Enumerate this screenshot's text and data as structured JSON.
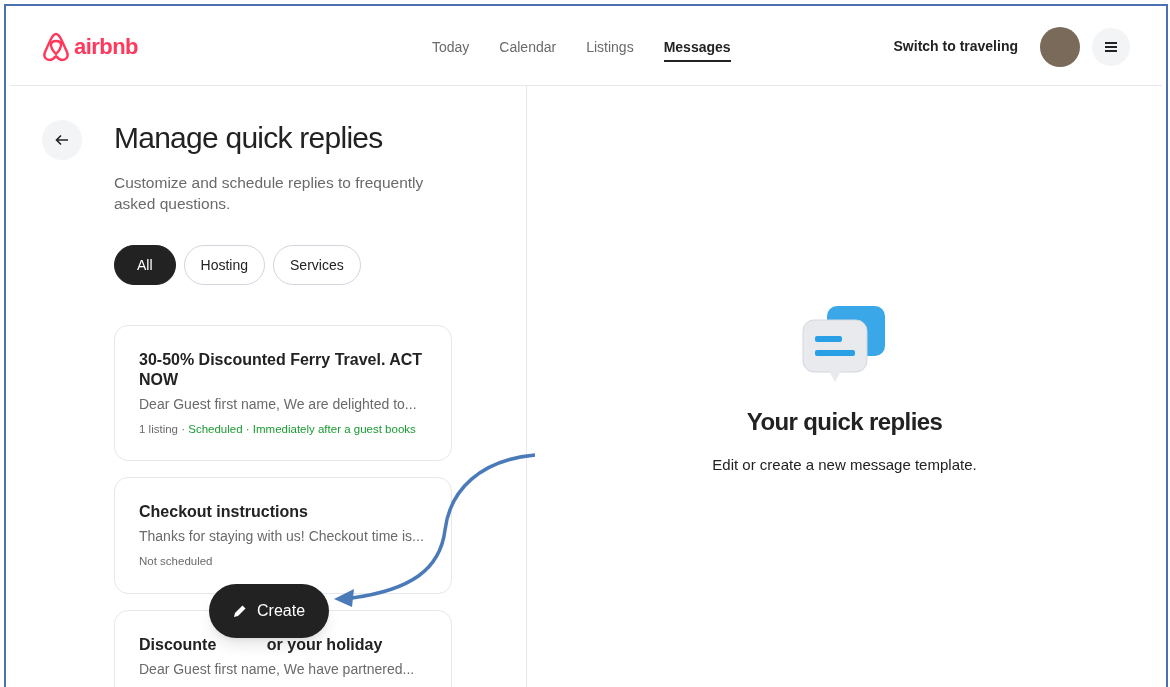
{
  "header": {
    "logo": "airbnb",
    "nav": [
      {
        "label": "Today",
        "selected": false
      },
      {
        "label": "Calendar",
        "selected": false
      },
      {
        "label": "Listings",
        "selected": false
      },
      {
        "label": "Messages",
        "selected": true
      }
    ],
    "switch_link": "Switch to traveling"
  },
  "panel": {
    "title": "Manage quick replies",
    "subtitle": "Customize and schedule replies to frequently asked questions.",
    "filters": [
      {
        "label": "All",
        "selected": true
      },
      {
        "label": "Hosting",
        "selected": false
      },
      {
        "label": "Services",
        "selected": false
      }
    ],
    "cards": [
      {
        "title_parts": [
          "30-50% Discounted Ferry Travel. ACT NOW"
        ],
        "preview": "Dear Guest first name, We are delighted to...",
        "meta": "1 listing · ",
        "schedule": "Scheduled · Immediately after a guest books",
        "scheduled": true
      },
      {
        "title_parts": [
          "Checkout instructions"
        ],
        "preview": "Thanks for staying with us! Checkout time is...",
        "schedule": "Not scheduled",
        "scheduled": false
      },
      {
        "title_parts": [
          "Discounte",
          "or your holiday"
        ],
        "preview": "Dear Guest first name, We have partnered..."
      }
    ],
    "create_button": "Create"
  },
  "empty_state": {
    "title": "Your quick replies",
    "text": "Edit or create a new message template."
  }
}
